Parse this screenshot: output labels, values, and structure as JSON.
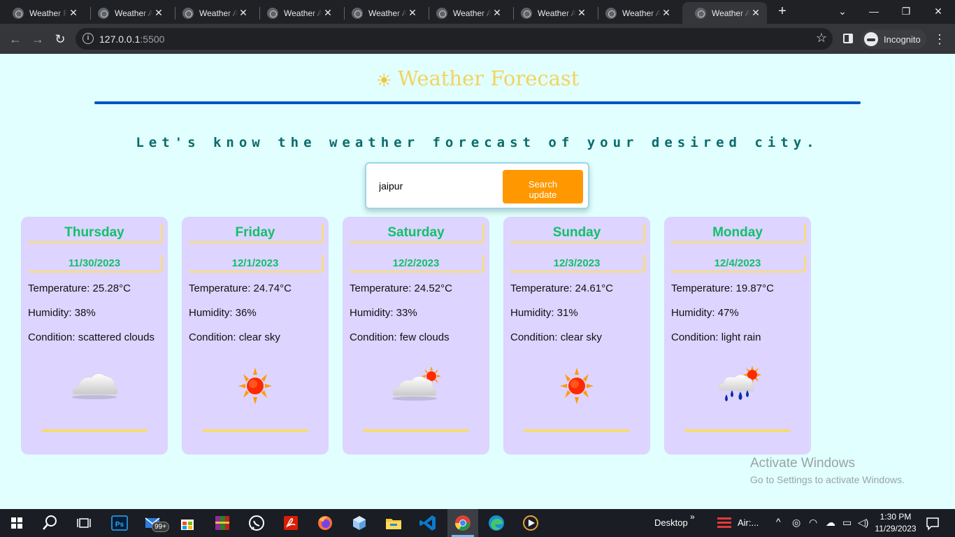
{
  "browser": {
    "tabs": [
      {
        "title": "Weather Forecast"
      },
      {
        "title": "Weather App"
      },
      {
        "title": "Weather App"
      },
      {
        "title": "Weather App"
      },
      {
        "title": "Weather App"
      },
      {
        "title": "Weather App"
      },
      {
        "title": "Weather App"
      },
      {
        "title": "Weather App"
      },
      {
        "title": "Weather App"
      }
    ],
    "active_tab_index": 8,
    "url_host": "127.0.0.1",
    "url_port": ":5500",
    "profile_label": "Incognito"
  },
  "page": {
    "title": "Weather Forecast",
    "tagline": "Let's know the weather forecast of your desired city.",
    "search": {
      "value": "jaipur",
      "button_label": "Search\nupdate"
    },
    "forecast": [
      {
        "day": "Thursday",
        "date": "11/30/2023",
        "temperature": "Temperature: 25.28°C",
        "humidity": "Humidity: 38%",
        "condition": "Condition: scattered clouds",
        "icon": "cloud-icon"
      },
      {
        "day": "Friday",
        "date": "12/1/2023",
        "temperature": "Temperature: 24.74°C",
        "humidity": "Humidity: 36%",
        "condition": "Condition: clear sky",
        "icon": "sun-icon"
      },
      {
        "day": "Saturday",
        "date": "12/2/2023",
        "temperature": "Temperature: 24.52°C",
        "humidity": "Humidity: 33%",
        "condition": "Condition: few clouds",
        "icon": "cloud-sun-icon"
      },
      {
        "day": "Sunday",
        "date": "12/3/2023",
        "temperature": "Temperature: 24.61°C",
        "humidity": "Humidity: 31%",
        "condition": "Condition: clear sky",
        "icon": "sun-icon"
      },
      {
        "day": "Monday",
        "date": "12/4/2023",
        "temperature": "Temperature: 19.87°C",
        "humidity": "Humidity: 47%",
        "condition": "Condition: light rain",
        "icon": "rain-sun-icon"
      }
    ],
    "watermark": {
      "line1": "Activate Windows",
      "line2": "Go to Settings to activate Windows."
    }
  },
  "taskbar": {
    "mail_badge": "99+",
    "desktop_label": "Desktop",
    "weather_label": "Air:...",
    "time": "1:30 PM",
    "date": "11/29/2023"
  },
  "colors": {
    "page_bg": "#e0fffe",
    "title": "#f4d35e",
    "divider": "#0054c7",
    "tagline": "#0b6b6b",
    "card_bg": "#ddd4ff",
    "day_text": "#12c06a",
    "search_button": "#ff9800"
  }
}
